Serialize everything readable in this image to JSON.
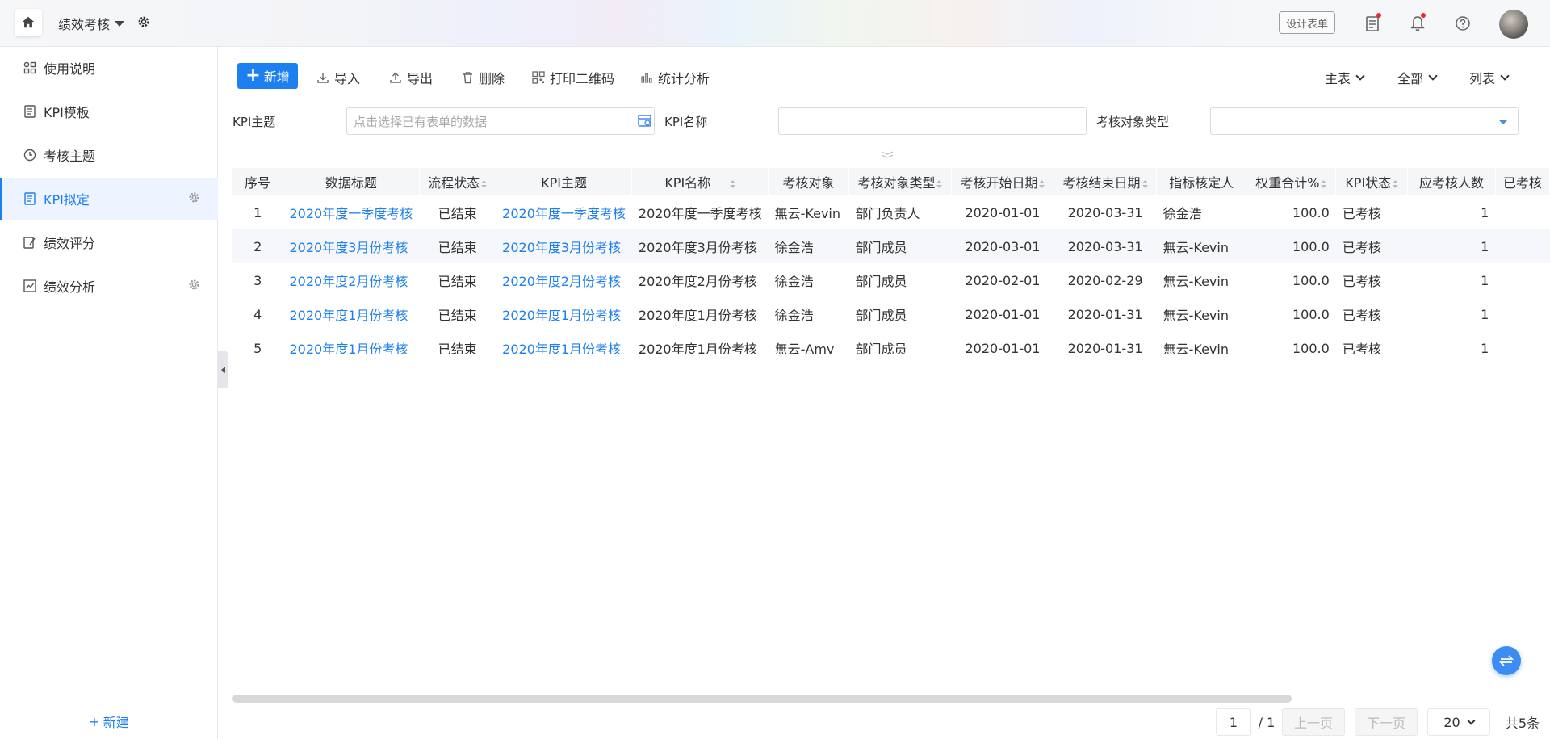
{
  "app": {
    "title": "绩效考核",
    "design_label": "设计表单"
  },
  "sidebar": {
    "items": [
      {
        "label": "使用说明",
        "icon": "app-grid-icon"
      },
      {
        "label": "KPI模板",
        "icon": "document-icon"
      },
      {
        "label": "考核主题",
        "icon": "clock-icon"
      },
      {
        "label": "KPI拟定",
        "icon": "document-icon",
        "active": true
      },
      {
        "label": "绩效评分",
        "icon": "edit-doc-icon"
      },
      {
        "label": "绩效分析",
        "icon": "chart-icon"
      }
    ],
    "new_label": "新建"
  },
  "toolbar": {
    "new_label": "新增",
    "import_label": "导入",
    "export_label": "导出",
    "delete_label": "删除",
    "qrcode_label": "打印二维码",
    "stats_label": "统计分析",
    "main_table_label": "主表",
    "all_label": "全部",
    "list_label": "列表"
  },
  "filters": {
    "kpi_topic_label": "KPI主题",
    "kpi_topic_placeholder": "点击选择已有表单的数据",
    "kpi_name_label": "KPI名称",
    "target_type_label": "考核对象类型"
  },
  "table": {
    "columns": [
      "序号",
      "数据标题",
      "流程状态",
      "KPI主题",
      "KPI名称",
      "考核对象",
      "考核对象类型",
      "考核开始日期",
      "考核结束日期",
      "指标核定人",
      "权重合计%",
      "KPI状态",
      "应考核人数",
      "已考核"
    ],
    "rows": [
      [
        "1",
        "2020年度一季度考核",
        "已结束",
        "2020年度一季度考核",
        "2020年度一季度考核",
        "無云-Kevin",
        "部门负责人",
        "2020-01-01",
        "2020-03-31",
        "徐金浩",
        "100.0",
        "已考核",
        "1",
        ""
      ],
      [
        "2",
        "2020年度3月份考核",
        "已结束",
        "2020年度3月份考核",
        "2020年度3月份考核",
        "徐金浩",
        "部门成员",
        "2020-03-01",
        "2020-03-31",
        "無云-Kevin",
        "100.0",
        "已考核",
        "1",
        ""
      ],
      [
        "3",
        "2020年度2月份考核",
        "已结束",
        "2020年度2月份考核",
        "2020年度2月份考核",
        "徐金浩",
        "部门成员",
        "2020-02-01",
        "2020-02-29",
        "無云-Kevin",
        "100.0",
        "已考核",
        "1",
        ""
      ],
      [
        "4",
        "2020年度1月份考核",
        "已结束",
        "2020年度1月份考核",
        "2020年度1月份考核",
        "徐金浩",
        "部门成员",
        "2020-01-01",
        "2020-01-31",
        "無云-Kevin",
        "100.0",
        "已考核",
        "1",
        ""
      ],
      [
        "5",
        "2020年度1月份考核",
        "已结束",
        "2020年度1月份考核",
        "2020年度1月份考核",
        "無云-Amy",
        "部门成员",
        "2020-01-01",
        "2020-01-31",
        "無云-Kevin",
        "100.0",
        "已考核",
        "1",
        ""
      ]
    ]
  },
  "pagination": {
    "page": "1",
    "total_pages": "/ 1",
    "prev_label": "上一页",
    "next_label": "下一页",
    "page_size": "20",
    "total_label": "共5条"
  },
  "colors": {
    "accent": "#1e7ff0"
  }
}
